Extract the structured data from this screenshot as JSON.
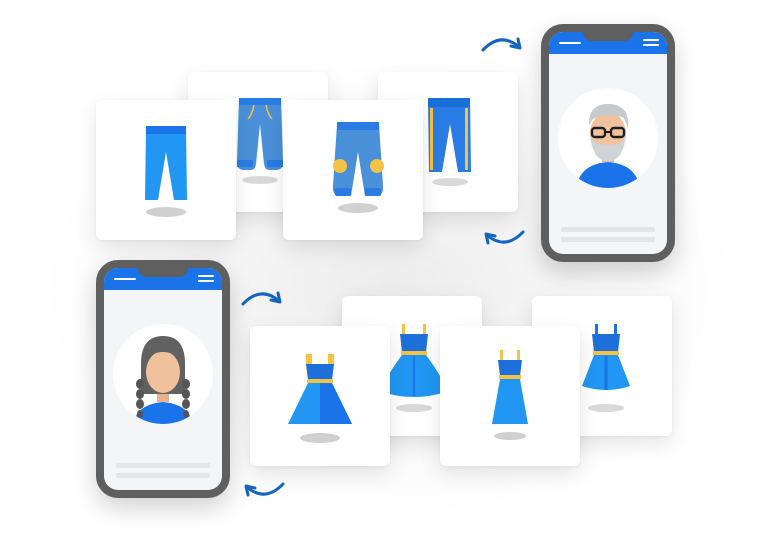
{
  "colors": {
    "primary_blue": "#1a73e8",
    "garment_blue": "#2196f3",
    "garment_light_blue": "#4a90d9",
    "accent_yellow": "#f5c242",
    "phone_frame": "#5f5f5f",
    "arrow": "#1565c0"
  },
  "phones": [
    {
      "id": "phone-top-right",
      "avatar": "older-man-with-glasses-avatar"
    },
    {
      "id": "phone-bottom-left",
      "avatar": "girl-with-braids-avatar"
    }
  ],
  "product_rows": [
    {
      "category": "pants",
      "icons": [
        "blue-pants-icon",
        "sweatpants-icon",
        "joggers-with-knee-patches-icon",
        "track-pants-with-stripes-icon"
      ]
    },
    {
      "category": "dresses",
      "icons": [
        "a-line-dress-icon",
        "flared-dress-icon",
        "slim-dress-icon",
        "ruffle-dress-icon"
      ]
    }
  ],
  "arrows": [
    "sync-arrow-top-right",
    "sync-arrow-bottom-right",
    "sync-arrow-top-left",
    "sync-arrow-bottom-left"
  ]
}
